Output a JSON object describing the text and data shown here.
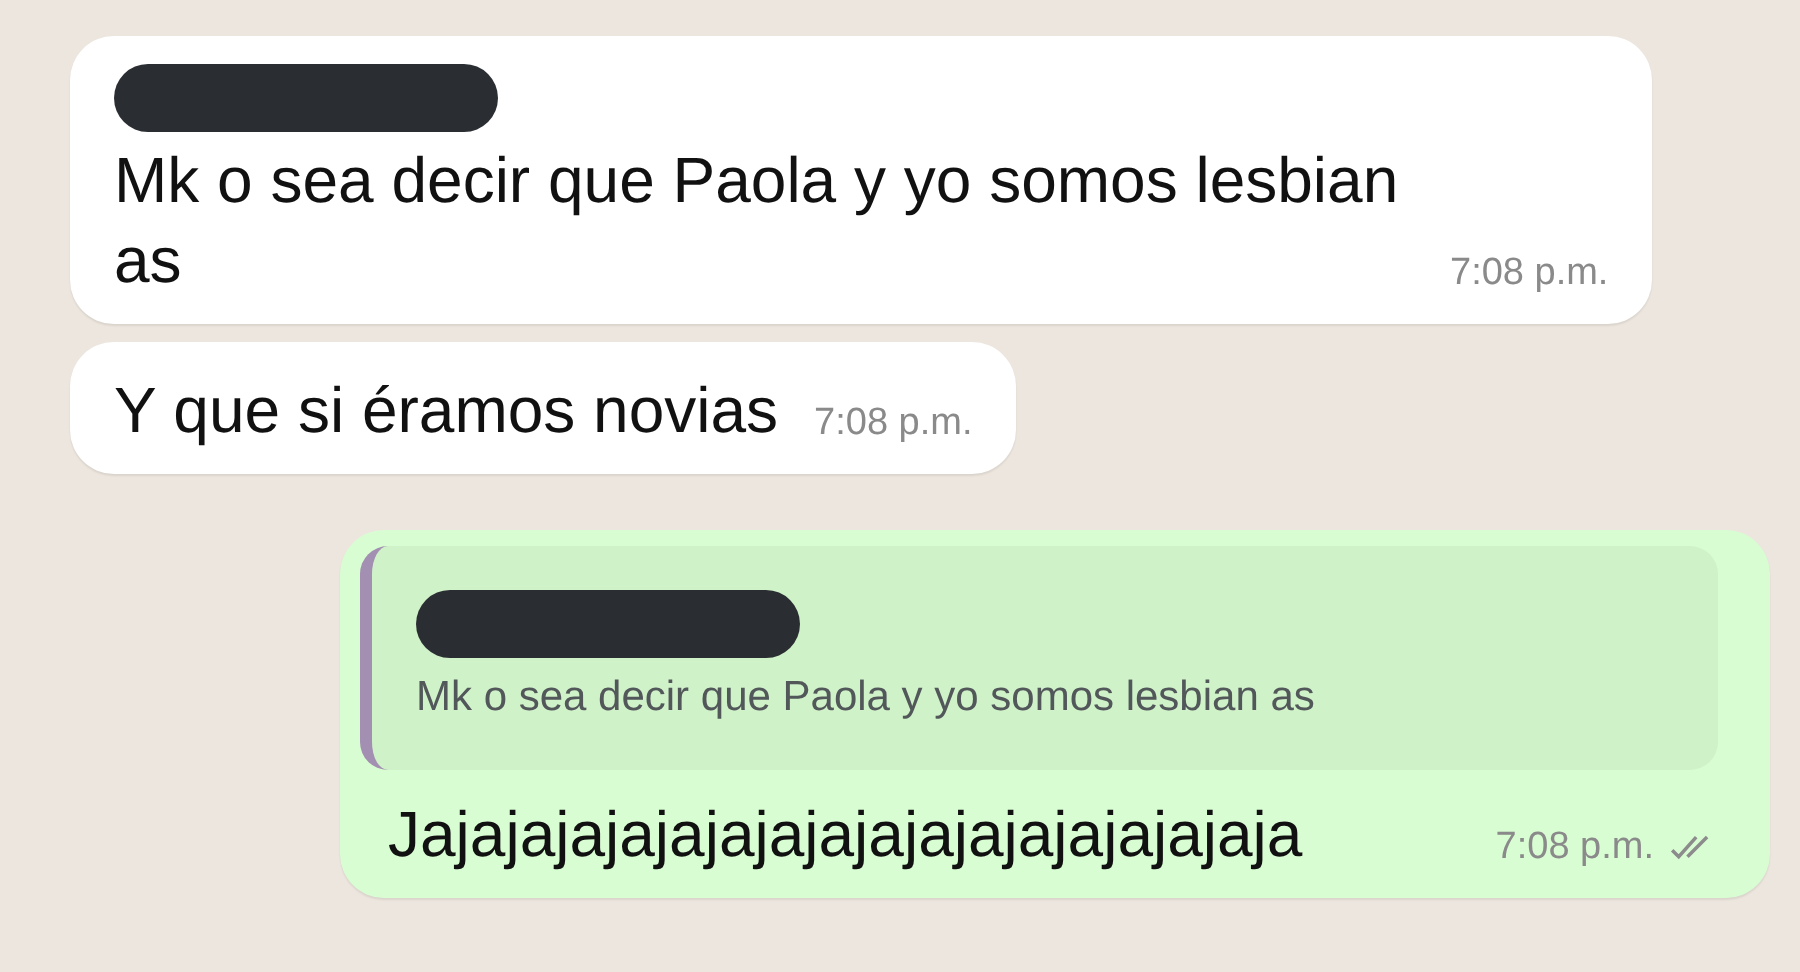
{
  "messages": [
    {
      "kind": "incoming",
      "sender_redacted": true,
      "text": "Mk o sea decir que Paola y yo somos lesbian as",
      "time": "7:08 p.m."
    },
    {
      "kind": "incoming",
      "text": "Y que si éramos novias",
      "time": "7:08 p.m."
    },
    {
      "kind": "outgoing",
      "reply_to": {
        "sender_redacted": true,
        "text": "Mk o sea decir que Paola y yo somos lesbian as"
      },
      "text": "Jajajajajajajajajajajajajajajajajaja",
      "time": "7:08 p.m.",
      "delivered": true,
      "read": false
    }
  ]
}
